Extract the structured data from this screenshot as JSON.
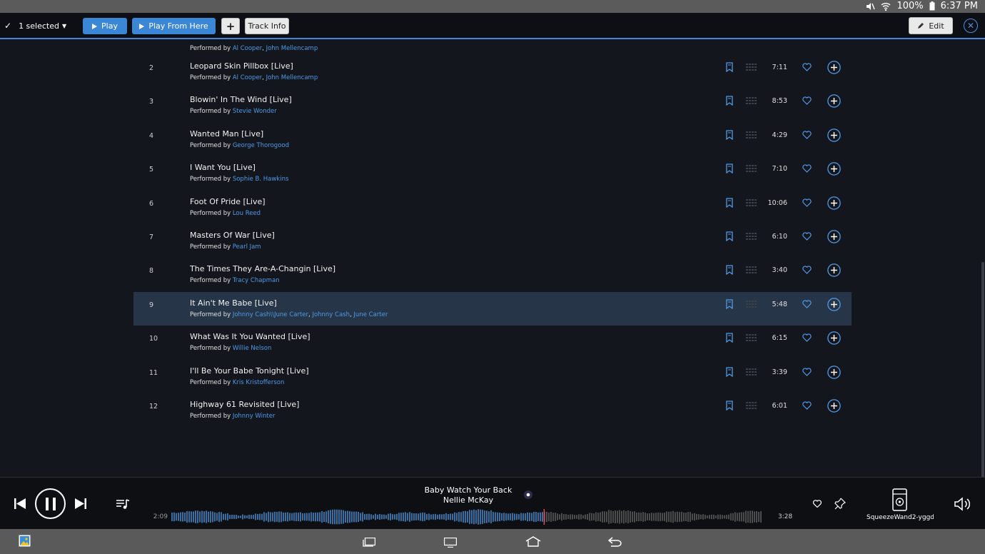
{
  "status_bar": {
    "battery": "100%",
    "time": "6:37 PM"
  },
  "toolbar": {
    "selected_label": "1 selected",
    "play_label": "Play",
    "play_from_here_label": "Play From Here",
    "add_label": "+",
    "track_info_label": "Track Info",
    "edit_label": "Edit"
  },
  "partial_row": {
    "performed_by": "Performed by",
    "artists": [
      "Al Cooper",
      "John Mellencamp"
    ]
  },
  "tracks": [
    {
      "num": "2",
      "title": "Leopard Skin Pillbox [Live]",
      "performed_by": "Performed by",
      "artists": [
        "Al Cooper",
        "John Mellencamp"
      ],
      "duration": "7:11"
    },
    {
      "num": "3",
      "title": "Blowin' In The Wind [Live]",
      "performed_by": "Performed by",
      "artists": [
        "Stevie Wonder"
      ],
      "duration": "8:53"
    },
    {
      "num": "4",
      "title": "Wanted Man [Live]",
      "performed_by": "Performed by",
      "artists": [
        "George Thorogood"
      ],
      "duration": "4:29"
    },
    {
      "num": "5",
      "title": "I Want You [Live]",
      "performed_by": "Performed by",
      "artists": [
        "Sophie B. Hawkins"
      ],
      "duration": "7:10"
    },
    {
      "num": "6",
      "title": "Foot Of Pride [Live]",
      "performed_by": "Performed by",
      "artists": [
        "Lou Reed"
      ],
      "duration": "10:06"
    },
    {
      "num": "7",
      "title": "Masters Of War [Live]",
      "performed_by": "Performed by",
      "artists": [
        "Pearl Jam"
      ],
      "duration": "6:10"
    },
    {
      "num": "8",
      "title": "The Times They Are-A-Changin [Live]",
      "performed_by": "Performed by",
      "artists": [
        "Tracy Chapman"
      ],
      "duration": "3:40"
    },
    {
      "num": "9",
      "title": "It Ain't Me Babe [Live]",
      "performed_by": "Performed by",
      "artists": [
        "Johnny Cash\\\\June Carter",
        "Johnny Cash",
        "June Carter"
      ],
      "duration": "5:48",
      "selected": true
    },
    {
      "num": "10",
      "title": "What Was It You Wanted [Live]",
      "performed_by": "Performed by",
      "artists": [
        "Willie Nelson"
      ],
      "duration": "6:15"
    },
    {
      "num": "11",
      "title": "I'll Be Your Babe Tonight [Live]",
      "performed_by": "Performed by",
      "artists": [
        "Kris Kristofferson"
      ],
      "duration": "3:39"
    },
    {
      "num": "12",
      "title": "Highway 61 Revisited [Live]",
      "performed_by": "Performed by",
      "artists": [
        "Johnny Winter"
      ],
      "duration": "6:01"
    }
  ],
  "player": {
    "title": "Baby Watch Your Back",
    "artist": "Nellie McKay",
    "elapsed": "2:09",
    "total": "3:28",
    "progress_fraction": 0.63,
    "device_name": "SqueezeWand2-yggdr"
  },
  "colors": {
    "accent": "#3c86d6",
    "link": "#4f9be8",
    "selected_row": "#263548",
    "background": "#14161d"
  },
  "icons": {
    "row": [
      "bookmark-icon",
      "queue-grid-icon",
      "heart-icon",
      "add-circle-icon"
    ],
    "player": [
      "previous-icon",
      "pause-icon",
      "next-icon",
      "playlist-icon",
      "heart-icon",
      "pin-icon",
      "speaker-device-icon",
      "volume-icon"
    ],
    "nav": [
      "gallery-icon",
      "recent-apps-icon",
      "desktop-icon",
      "home-icon",
      "back-icon"
    ]
  }
}
